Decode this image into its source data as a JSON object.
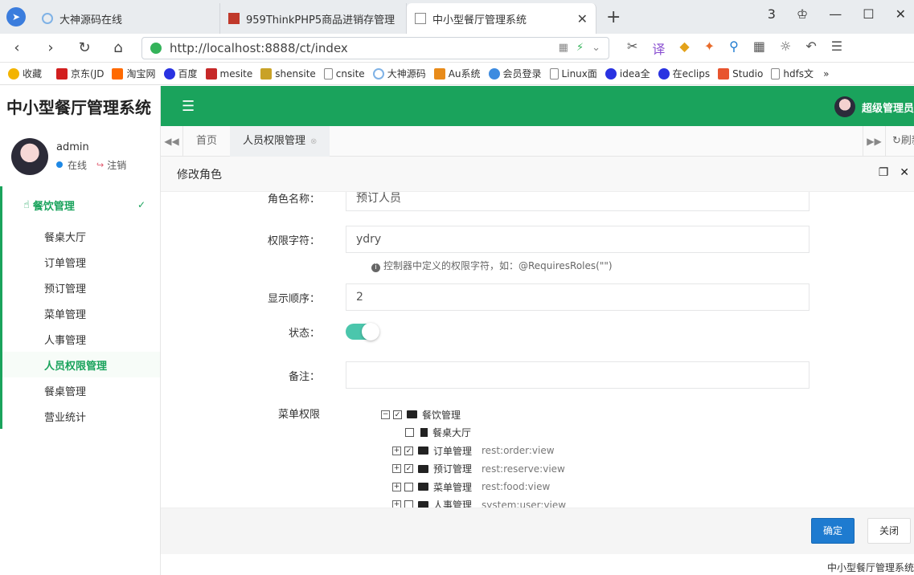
{
  "browser": {
    "tabs": [
      {
        "title": "大神源码在线"
      },
      {
        "title": "959ThinkPHP5商品进销存管理"
      },
      {
        "title": "中小型餐厅管理系统"
      }
    ],
    "window_controls": [
      "3",
      "□",
      "—",
      "☐",
      "✕"
    ],
    "url": "http://localhost:8888/ct/index",
    "bookmarks": [
      "收藏",
      "京东(JD",
      "淘宝网",
      "百度",
      "mesite",
      "shensite",
      "cnsite",
      "大神源码",
      "Au系统",
      "会员登录",
      "Linux面",
      "idea全",
      "在eclips",
      "Studio",
      "hdfs文",
      "»"
    ]
  },
  "app": {
    "brand": "中小型餐厅管理系统",
    "top_user": "超级管理员",
    "profile": {
      "name": "admin",
      "status": "在线",
      "logout": "注销"
    },
    "menu": {
      "group": "餐饮管理",
      "items": [
        "餐桌大厅",
        "订单管理",
        "预订管理",
        "菜单管理",
        "人事管理",
        "人员权限管理",
        "餐桌管理",
        "营业统计"
      ]
    },
    "page_tabs": {
      "home": "首页",
      "current": "人员权限管理",
      "refresh": "刷新"
    }
  },
  "modal": {
    "title": "修改角色",
    "fields": {
      "role_name_label": "角色名称：",
      "role_name_value": "预订人员",
      "role_key_label": "权限字符：",
      "role_key_value": "ydry",
      "role_key_hint": "控制器中定义的权限字符，如：@RequiresRoles(\"\")",
      "sort_label": "显示顺序：",
      "sort_value": "2",
      "status_label": "状态：",
      "remark_label": "备注：",
      "remark_value": "",
      "menu_label": "菜单权限"
    },
    "tree": [
      {
        "label": "餐饮管理",
        "perm": ""
      },
      {
        "label": "餐桌大厅",
        "perm": ""
      },
      {
        "label": "订单管理",
        "perm": "rest:order:view"
      },
      {
        "label": "预订管理",
        "perm": "rest:reserve:view"
      },
      {
        "label": "菜单管理",
        "perm": "rest:food:view"
      },
      {
        "label": "人事管理",
        "perm": "system:user:view"
      }
    ],
    "buttons": {
      "ok": "确定",
      "close": "关闭"
    }
  },
  "footer": "中小型餐厅管理系统",
  "colors": {
    "brand_green": "#1aa35c",
    "primary_blue": "#1e7bd0",
    "toggle_on": "#4bc6ac"
  }
}
